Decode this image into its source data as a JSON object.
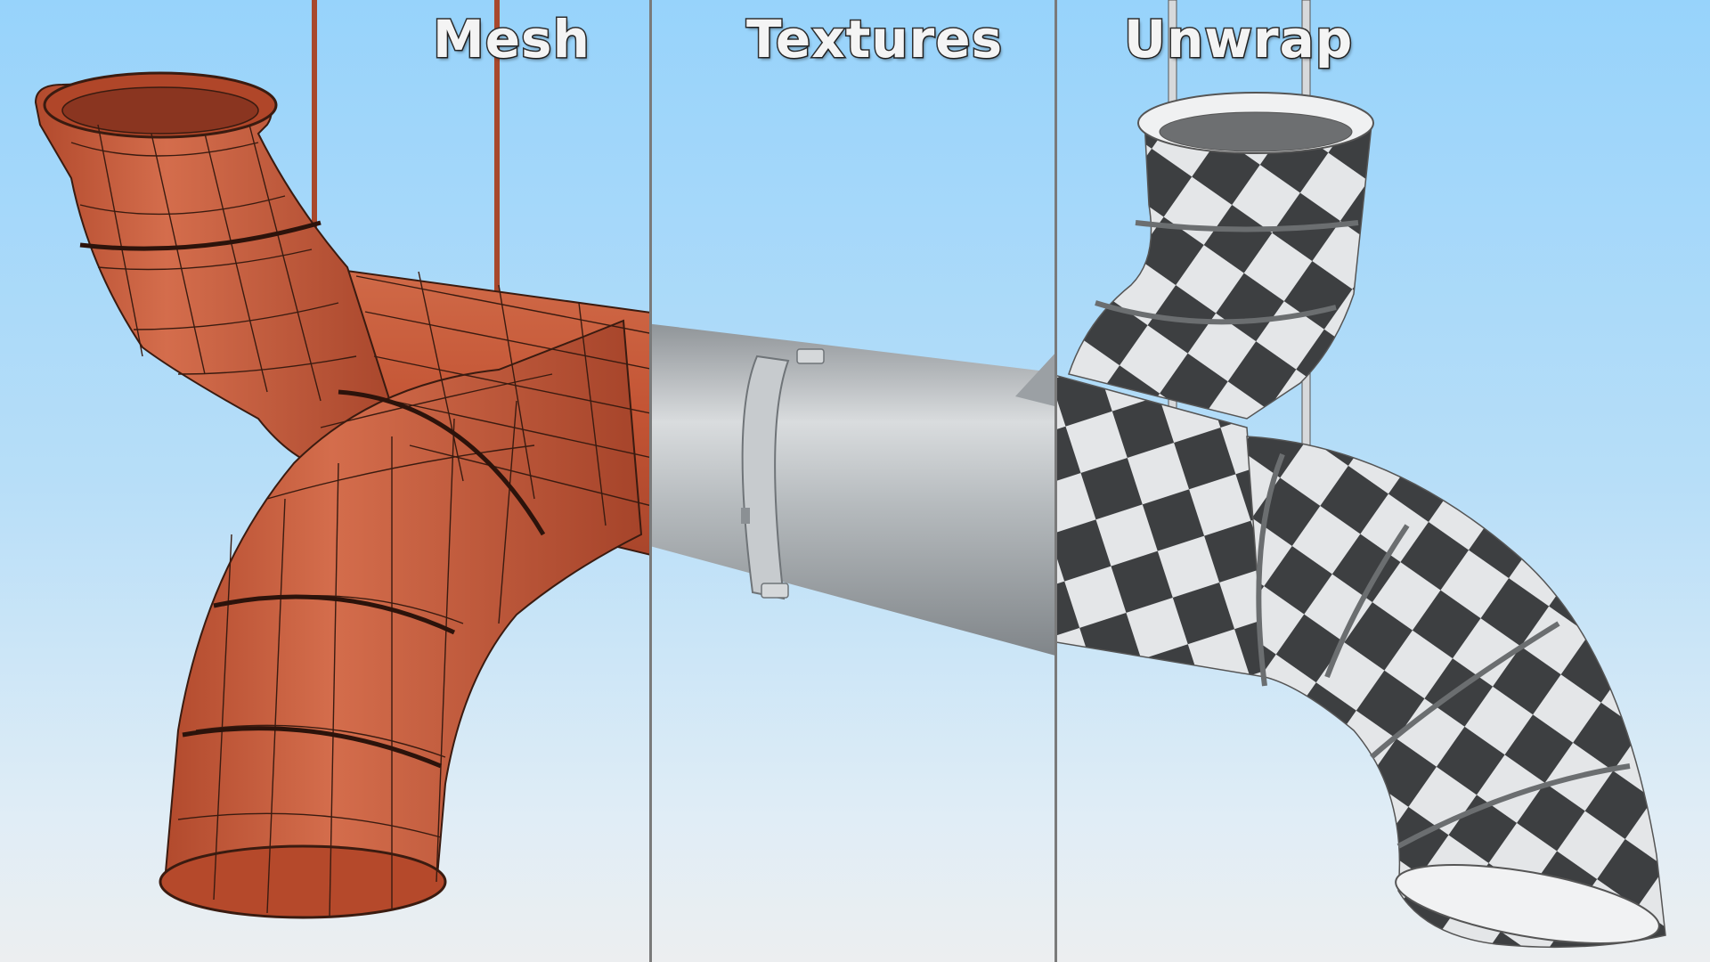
{
  "panels": [
    {
      "label": "Mesh"
    },
    {
      "label": "Textures"
    },
    {
      "label": "Unwrap"
    }
  ],
  "colors": {
    "mesh": "#c65a3a",
    "metal": "#b8bdc1",
    "checker_dark": "#3e3e3e",
    "checker_light": "#e6e6e6",
    "divider": "#7a7a7a"
  }
}
